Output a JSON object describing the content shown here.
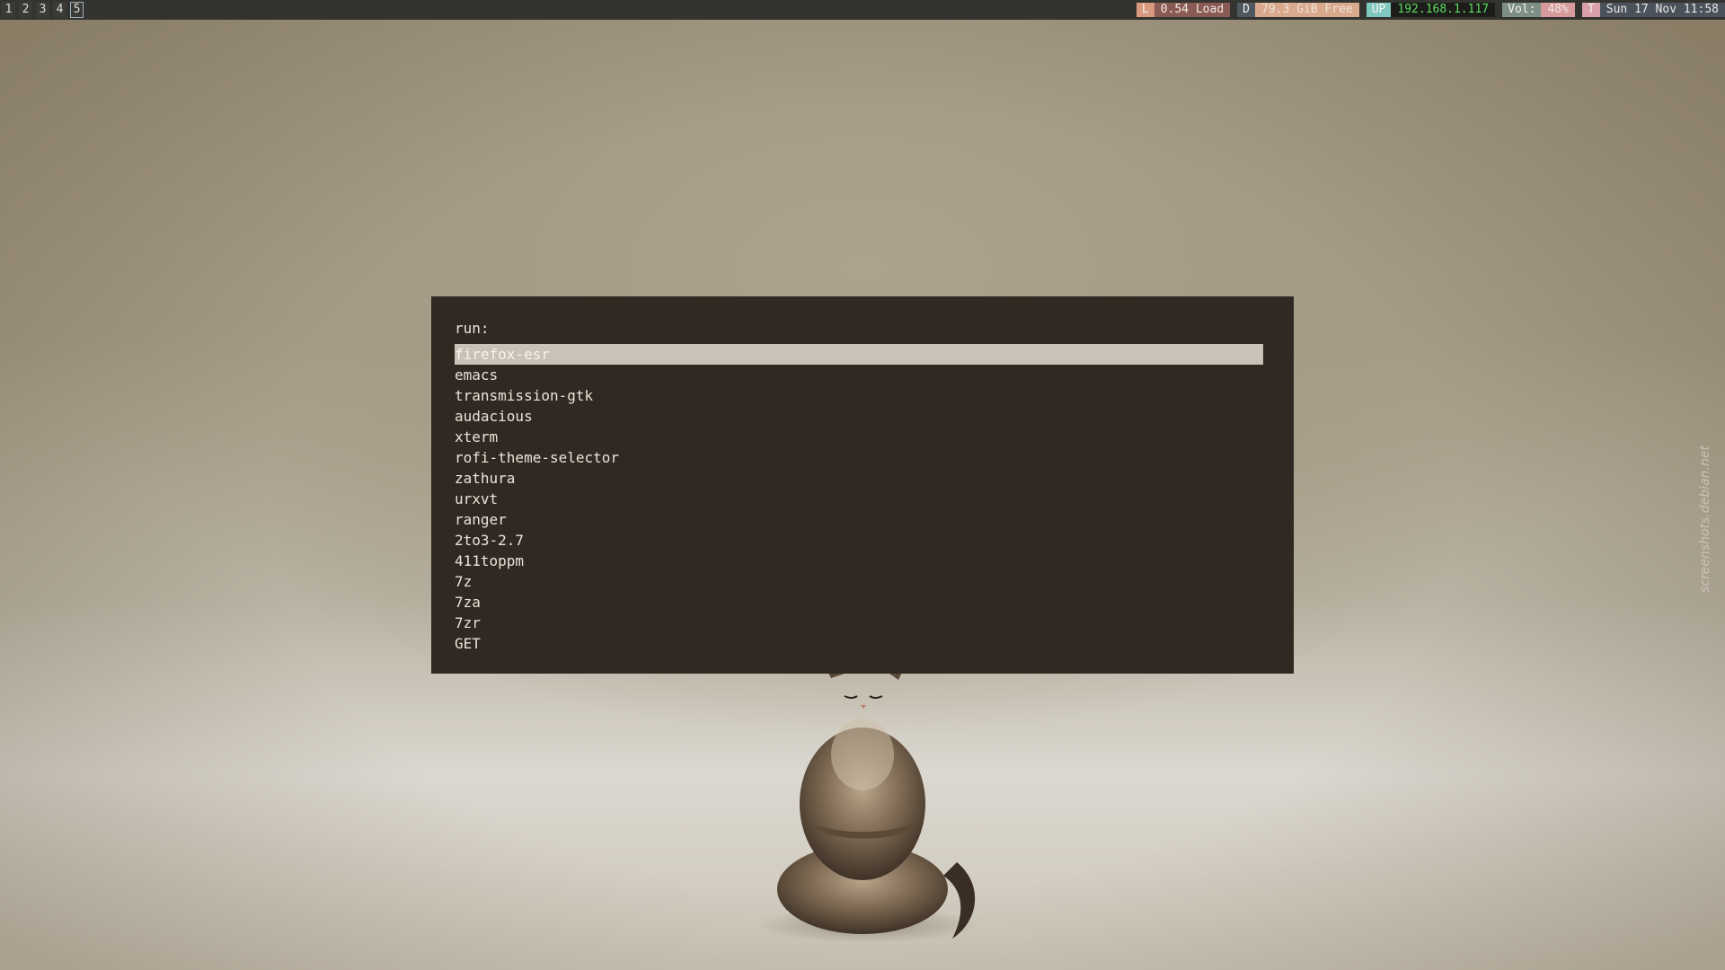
{
  "workspaces": [
    {
      "label": "1",
      "active": false
    },
    {
      "label": "2",
      "active": false
    },
    {
      "label": "3",
      "active": false
    },
    {
      "label": "4",
      "active": false
    },
    {
      "label": "5",
      "active": true
    }
  ],
  "status": {
    "load": {
      "tag": "L",
      "value": "0.54 Load",
      "tag_bg": "#d79a7e",
      "value_bg": "#8a5a55",
      "value_color": "#f2e8e2"
    },
    "disk": {
      "tag": "D",
      "value": "79.3 GiB Free",
      "tag_bg": "#4f5860",
      "value_bg": "#d9a98e",
      "value_color": "#f0e2d5"
    },
    "network": {
      "tag": "UP",
      "value": "192.168.1.117",
      "tag_bg": "#7fc8c0",
      "value_bg": "#1c1c1a",
      "value_color": "#5cdc5c"
    },
    "volume": {
      "tag": "Vol:",
      "value": "48%",
      "tag_bg": "#7e8f86",
      "value_bg": "#d79a9a",
      "value_color": "#f0e6e6"
    },
    "time": {
      "tag": "T",
      "value": "Sun 17 Nov 11:58",
      "tag_bg": "#d8a0a8",
      "value_bg": "#4c525c",
      "value_color": "#e6e6e6"
    }
  },
  "launcher": {
    "prompt": "run:",
    "items": [
      "firefox-esr",
      "emacs",
      "transmission-gtk",
      "audacious",
      "xterm",
      "rofi-theme-selector",
      "zathura",
      "urxvt",
      "ranger",
      "2to3-2.7",
      "411toppm",
      "7z",
      "7za",
      "7zr",
      "GET"
    ],
    "selected_index": 0
  },
  "watermark": "screenshots.debian.net"
}
